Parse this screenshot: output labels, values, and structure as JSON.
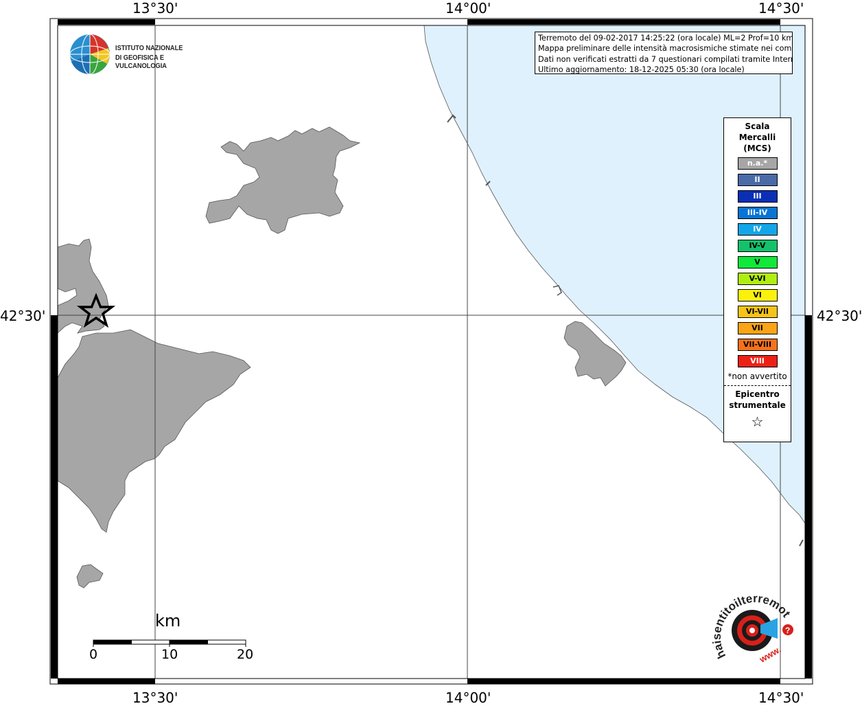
{
  "map": {
    "graticule": {
      "lon_labels": [
        "13°30'",
        "14°00'",
        "14°30'"
      ],
      "lat_labels": [
        "42°30'"
      ]
    },
    "sea_color": "#dff1fc",
    "land_color": "#a6a6a6"
  },
  "info_box": {
    "line1": "Terremoto del 09-02-2017 14:25:22 (ora locale) ML=2 Prof=10 km",
    "line2": "Mappa preliminare delle intensità macrosismiche stimate nei comuni",
    "line3": "Dati non verificati estratti da 7 questionari compilati tramite Internet.",
    "line4": "Ultimo aggiornamento: 18-12-2025 05:30 (ora locale)"
  },
  "logo": {
    "line1": "ISTITUTO NAZIONALE",
    "line2": "DI GEOFISICA E VULCANOLOGIA"
  },
  "legend": {
    "title1": "Scala",
    "title2": "Mercalli",
    "title3": "(MCS)",
    "items": [
      {
        "label": "n.a.*",
        "color": "#a6a6a6",
        "text_color": "#ffffff"
      },
      {
        "label": "II",
        "color": "#4a6aa8",
        "text_color": "#ffffff"
      },
      {
        "label": "III",
        "color": "#0a2fb6",
        "text_color": "#ffffff"
      },
      {
        "label": "III-IV",
        "color": "#0a74d4",
        "text_color": "#ffffff"
      },
      {
        "label": "IV",
        "color": "#12a6e8",
        "text_color": "#ffffff"
      },
      {
        "label": "IV-V",
        "color": "#13c26a",
        "text_color": "#000000"
      },
      {
        "label": "V",
        "color": "#10e83a",
        "text_color": "#000000"
      },
      {
        "label": "V-VI",
        "color": "#b0ee12",
        "text_color": "#000000"
      },
      {
        "label": "VI",
        "color": "#fbf10d",
        "text_color": "#000000"
      },
      {
        "label": "VI-VII",
        "color": "#f5c418",
        "text_color": "#000000"
      },
      {
        "label": "VII",
        "color": "#fba416",
        "text_color": "#000000"
      },
      {
        "label": "VII-VIII",
        "color": "#f5711b",
        "text_color": "#000000"
      },
      {
        "label": "VIII",
        "color": "#ec2116",
        "text_color": "#ffffff"
      }
    ],
    "note": "*non avvertito",
    "epicenter1": "Epicentro",
    "epicenter2": "strumentale",
    "star": "☆"
  },
  "scale_bar": {
    "title": "km",
    "labels": [
      "0",
      "10",
      "20"
    ]
  },
  "hst_logo": {
    "text": "haisentitoilterremoto.it",
    "www": "www."
  }
}
